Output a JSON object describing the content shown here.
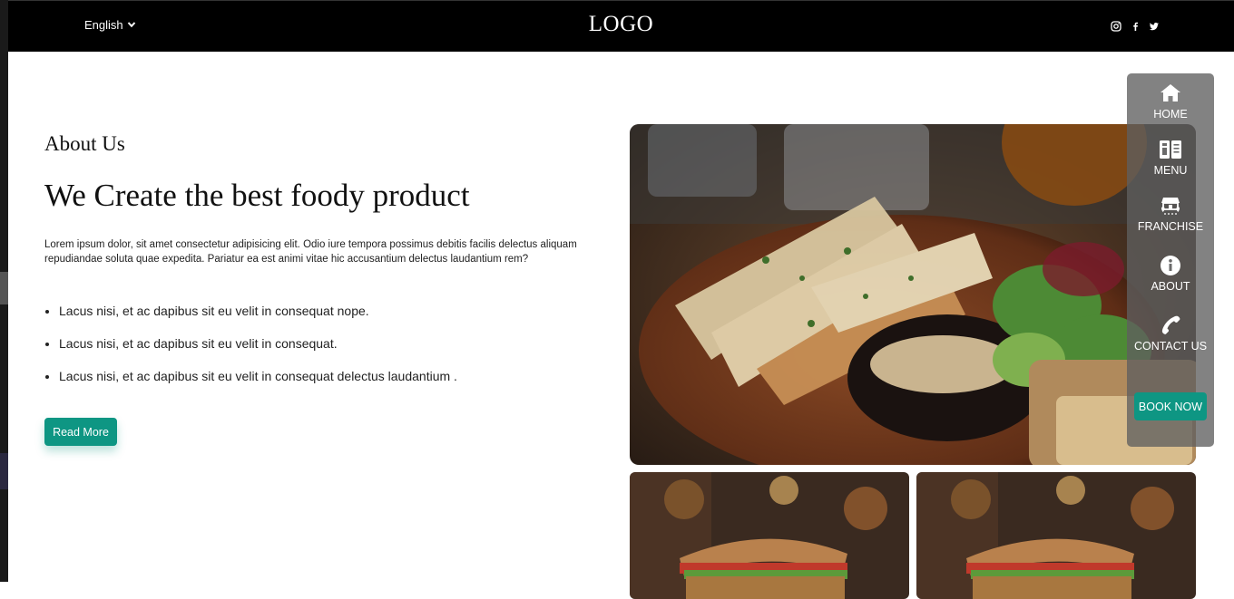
{
  "header": {
    "language": "English",
    "logo": "LOGO",
    "social_icons": [
      "instagram-icon",
      "facebook-icon",
      "twitter-icon"
    ]
  },
  "about": {
    "eyebrow": "About Us",
    "heading": "We Create the best foody product",
    "paragraph": "Lorem ipsum dolor, sit amet consectetur adipisicing elit. Odio iure tempora possimus debitis facilis delectus aliquam repudiandae soluta quae expedita. Pariatur ea est animi vitae hic accusantium delectus laudantium rem?",
    "bullets": [
      "Lacus nisi, et ac dapibus sit eu velit in consequat nope.",
      "Lacus nisi, et ac dapibus sit eu velit in consequat.",
      "Lacus nisi, et ac dapibus sit eu velit in consequat delectus laudantium ."
    ],
    "read_more": "Read More"
  },
  "sidenav": {
    "items": [
      {
        "label": "HOME",
        "icon": "home-icon"
      },
      {
        "label": "MENU",
        "icon": "menu-book-icon"
      },
      {
        "label": "FRANCHISE",
        "icon": "store-icon"
      },
      {
        "label": "ABOUT",
        "icon": "info-icon"
      },
      {
        "label": "CONTACT US",
        "icon": "phone-icon"
      }
    ],
    "book_now": "BOOK NOW"
  },
  "colors": {
    "accent": "#0e9683",
    "header_bg": "#000000",
    "sidenav_bg": "#5f5f5f"
  }
}
